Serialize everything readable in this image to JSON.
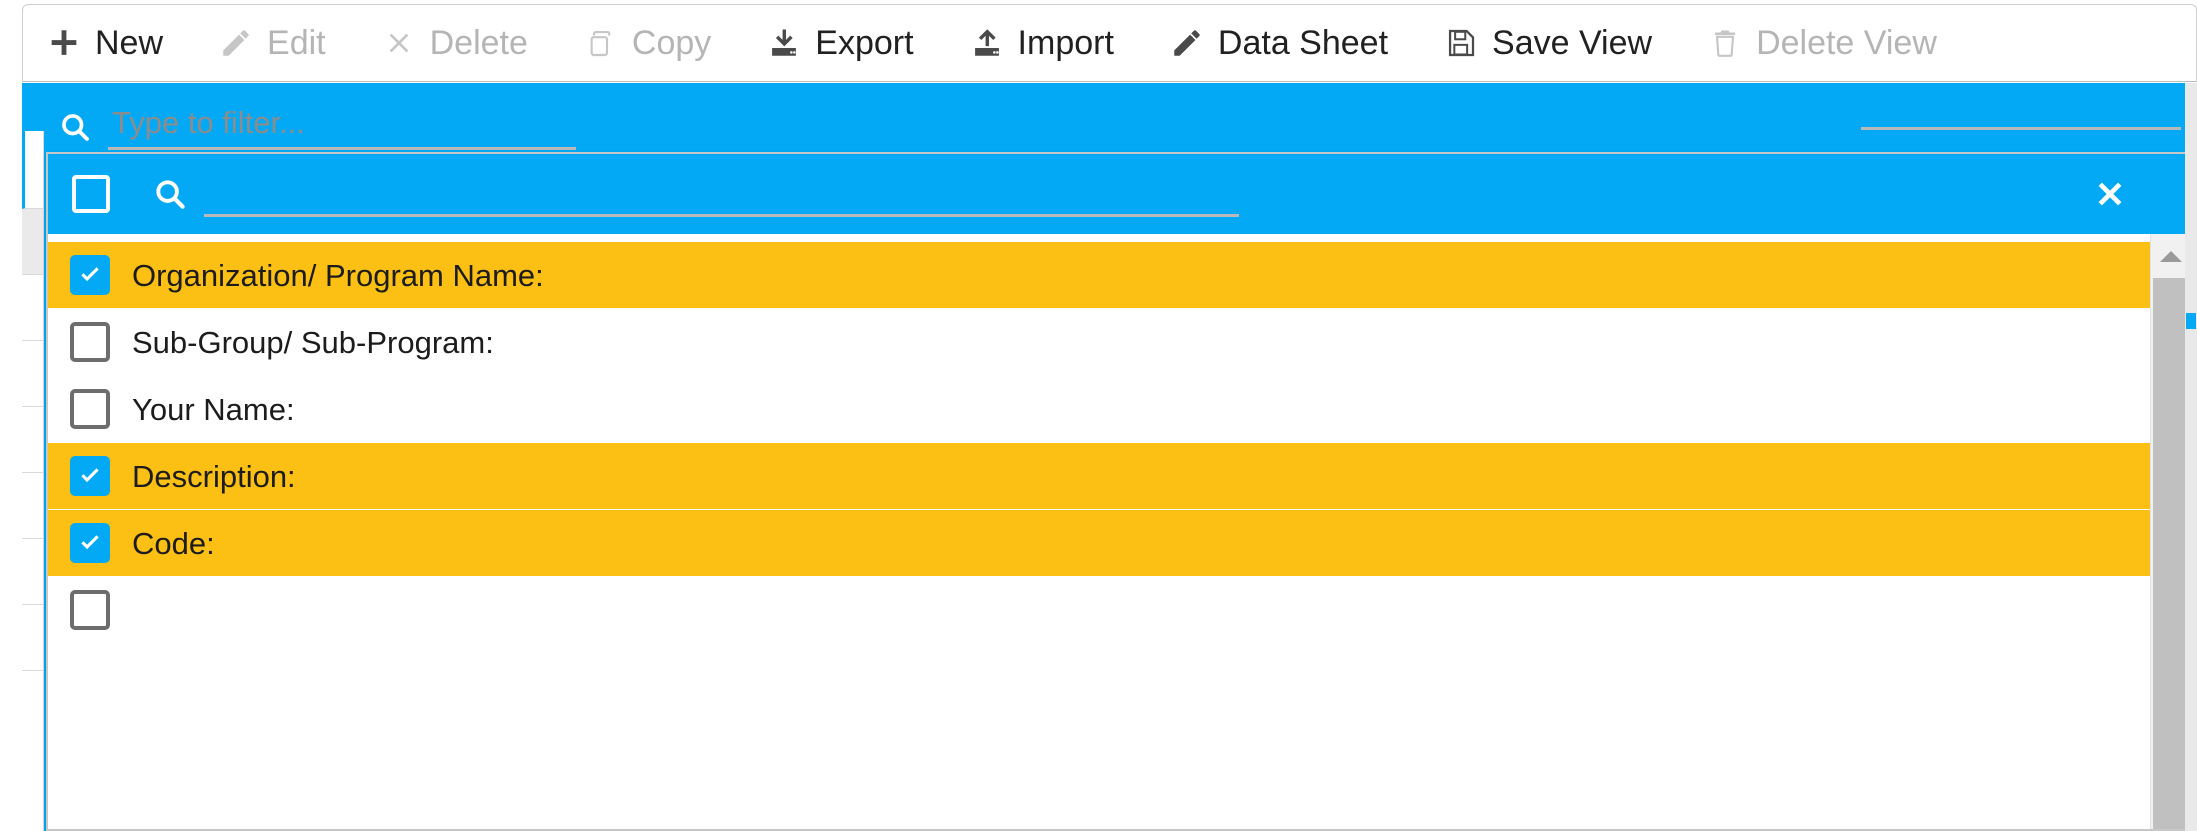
{
  "toolbar": {
    "items": [
      {
        "label": "New",
        "icon": "plus-icon",
        "disabled": false
      },
      {
        "label": "Edit",
        "icon": "pencil-icon",
        "disabled": true
      },
      {
        "label": "Delete",
        "icon": "x-mark-icon",
        "disabled": true
      },
      {
        "label": "Copy",
        "icon": "copy-icon",
        "disabled": true
      },
      {
        "label": "Export",
        "icon": "download-icon",
        "disabled": false
      },
      {
        "label": "Import",
        "icon": "upload-icon",
        "disabled": false
      },
      {
        "label": "Data Sheet",
        "icon": "pencil-icon",
        "disabled": false
      },
      {
        "label": "Save View",
        "icon": "floppy-disk-icon",
        "disabled": false
      },
      {
        "label": "Delete View",
        "icon": "trash-icon",
        "disabled": true
      }
    ]
  },
  "filter_bar": {
    "search_placeholder": "Type to filter...",
    "search_value": "",
    "background_color": "#03a9f4"
  },
  "panel": {
    "header": {
      "select_all_checked": false,
      "search_placeholder": "",
      "search_value": "",
      "close_label": "✕"
    },
    "columns": [
      {
        "label": "Organization/ Program Name:",
        "checked": true
      },
      {
        "label": "Sub-Group/ Sub-Program:",
        "checked": false
      },
      {
        "label": "Your Name:",
        "checked": false
      },
      {
        "label": "Description:",
        "checked": true
      },
      {
        "label": "Code:",
        "checked": true
      },
      {
        "label": "",
        "checked": false
      }
    ],
    "highlight_color": "#fcbf14",
    "checkbox_color": "#03a9f4"
  }
}
